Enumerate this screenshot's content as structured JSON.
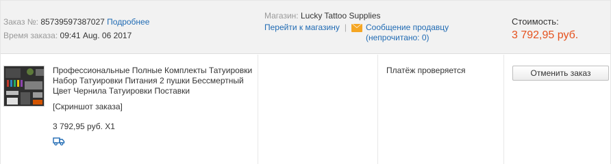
{
  "order": {
    "number_label": "Заказ №:",
    "number": "85739597387027",
    "details_link": "Подробнее",
    "time_label": "Время заказа:",
    "time": "09:41 Aug. 06 2017"
  },
  "store": {
    "label": "Магазин:",
    "name": "Lucky Tattoo Supplies",
    "go_to_store": "Перейти к магазину",
    "separator": "|",
    "message_seller": "Сообщение продавцу",
    "unread": "(непрочитано: 0)"
  },
  "cost": {
    "label": "Стоимость:",
    "value": "3 792,95 руб."
  },
  "item": {
    "title": "Профессиональные Полные Комплекты Татуировки Набор Татуировки Питания 2 пушки Бессмертный Цвет Чернила Татуировки Поставки",
    "snapshot": "[Скриншот заказа]",
    "price_qty": "3 792,95 руб. X1",
    "shipping_icon": "truck-icon"
  },
  "status": "Платёж проверяется",
  "actions": {
    "cancel_label": "Отменить заказ"
  },
  "colors": {
    "link": "#1f6ab3",
    "price": "#e5511d",
    "header_bg": "#f2f2f2",
    "mail_icon": "#f5a623"
  }
}
